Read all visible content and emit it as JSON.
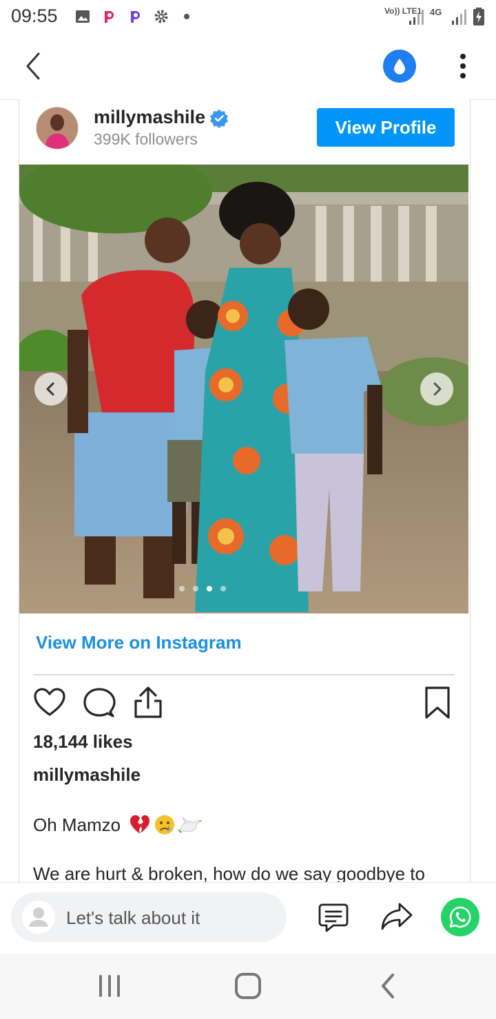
{
  "status_bar": {
    "time": "09:55",
    "network_1": "Vo)) LTE1",
    "network_2": "4G",
    "icons": [
      "gallery-icon",
      "p-app-icon",
      "p-app-icon",
      "settings-icon",
      "dot-icon",
      "signal-icon",
      "signal-icon",
      "battery-charging-icon"
    ]
  },
  "top_bar": {
    "back_icon": "chevron-left-icon",
    "drop_icon": "water-drop-icon",
    "menu_icon": "more-vertical-icon",
    "accent": "#1f7ff0"
  },
  "post": {
    "username": "millymashile",
    "verified": true,
    "followers": "399K followers",
    "view_profile_label": "View Profile",
    "view_more_label": "View More on Instagram",
    "likes": "18,144 likes",
    "caption_user": "millymashile",
    "caption_line1": "Oh Mamzo",
    "caption_emojis": [
      "broken-heart-icon",
      "crying-face-icon",
      "dove-icon"
    ],
    "caption_line2": "We are hurt & broken, how do we say goodbye to",
    "carousel_dots": 4,
    "active_dot": 2
  },
  "comment_bar": {
    "placeholder": "Let's talk about it"
  },
  "colors": {
    "brand_blue": "#0095f6",
    "link_blue": "#1a8fe0",
    "whatsapp_green": "#25d366"
  }
}
